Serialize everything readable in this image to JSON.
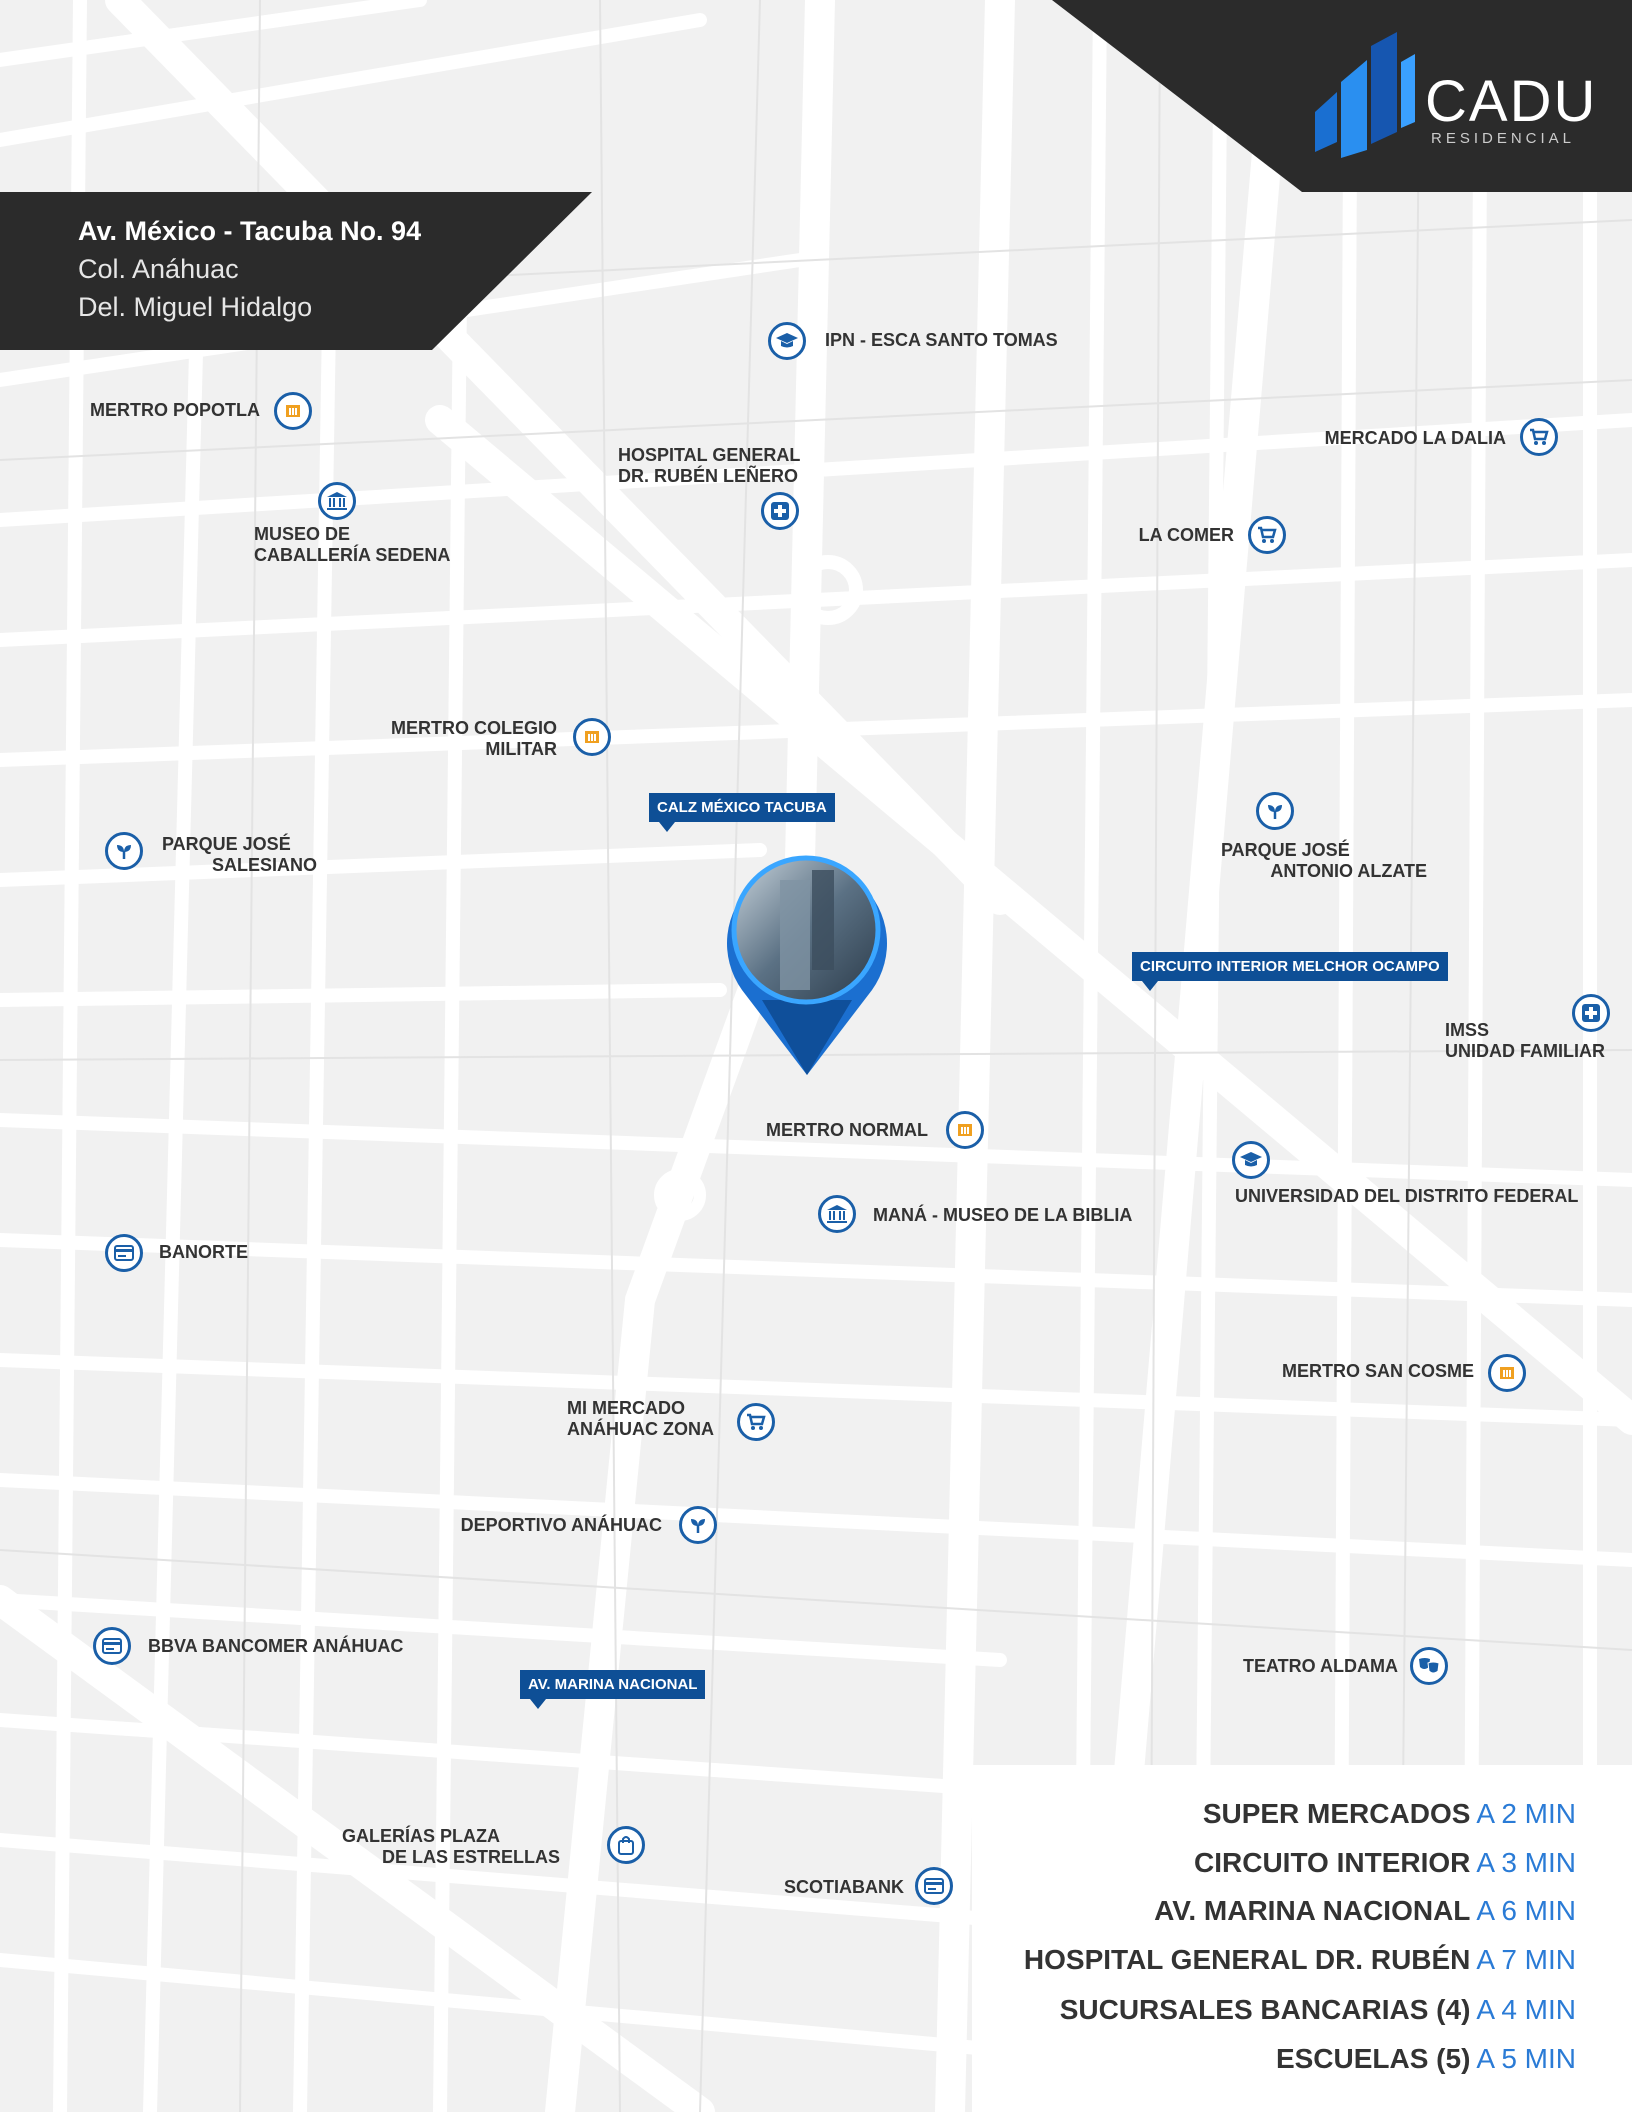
{
  "brand": {
    "name": "CADU",
    "sub": "RESIDENCIAL"
  },
  "address": {
    "line1": "Av. México - Tacuba No. 94",
    "line2": "Col. Anáhuac",
    "line3": "Del. Miguel Hidalgo"
  },
  "pois": [
    {
      "label": "IPN - ESCA SANTO TOMAS",
      "icon": "graduation-cap-icon"
    },
    {
      "label": "MERTRO POPOTLA",
      "icon": "metro-icon"
    },
    {
      "label": "MERCADO LA DALIA",
      "icon": "cart-icon"
    },
    {
      "label": "HOSPITAL GENERAL\nDR. RUBÉN LEÑERO",
      "icon": "hospital-icon"
    },
    {
      "label": "MUSEO DE\nCABALLERÍA SEDENA",
      "icon": "museum-icon"
    },
    {
      "label": "LA COMER",
      "icon": "cart-icon"
    },
    {
      "label": "MERTRO COLEGIO\nMILITAR",
      "icon": "metro-icon"
    },
    {
      "label": "PARQUE JOSÉ\n          SALESIANO",
      "icon": "park-icon"
    },
    {
      "label": "PARQUE JOSÉ\n          ANTONIO ALZATE",
      "icon": "park-icon"
    },
    {
      "label": "IMSS\nUNIDAD FAMILIAR",
      "icon": "hospital-icon"
    },
    {
      "label": "MERTRO NORMAL",
      "icon": "metro-icon"
    },
    {
      "label": "UNIVERSIDAD DEL DISTRITO FEDERAL",
      "icon": "graduation-cap-icon"
    },
    {
      "label": "MANÁ - MUSEO DE LA BIBLIA",
      "icon": "museum-icon"
    },
    {
      "label": "BANORTE",
      "icon": "bank-card-icon"
    },
    {
      "label": "MERTRO SAN COSME",
      "icon": "metro-icon"
    },
    {
      "label": "MI MERCADO\nANÁHUAC ZONA",
      "icon": "cart-icon"
    },
    {
      "label": "DEPORTIVO ANÁHUAC",
      "icon": "park-icon"
    },
    {
      "label": "BBVA BANCOMER ANÁHUAC",
      "icon": "bank-card-icon"
    },
    {
      "label": "TEATRO ALDAMA",
      "icon": "theater-icon"
    },
    {
      "label": "GALERÍAS PLAZA\n        DE LAS ESTRELLAS",
      "icon": "shopping-bag-icon"
    },
    {
      "label": "SCOTIABANK",
      "icon": "bank-card-icon"
    }
  ],
  "streets": [
    "CALZ MÉXICO TACUBA",
    "CIRCUITO INTERIOR MELCHOR OCAMPO",
    "AV. MARINA NACIONAL"
  ],
  "legend": [
    {
      "name": "SUPER MERCADOS",
      "time": "A 2 MIN"
    },
    {
      "name": "CIRCUITO INTERIOR",
      "time": "A 3 MIN"
    },
    {
      "name": "AV. MARINA NACIONAL",
      "time": "A 6 MIN"
    },
    {
      "name": "HOSPITAL GENERAL DR. RUBÉN",
      "time": "A 7 MIN"
    },
    {
      "name": "SUCURSALES BANCARIAS (4)",
      "time": "A 4 MIN"
    },
    {
      "name": "ESCUELAS (5)",
      "time": "A 5 MIN"
    }
  ],
  "colors": {
    "accent": "#1a5fa8",
    "dark": "#2b2b2b",
    "metro": "#f0a020",
    "legend_time": "#2a7bd6"
  }
}
